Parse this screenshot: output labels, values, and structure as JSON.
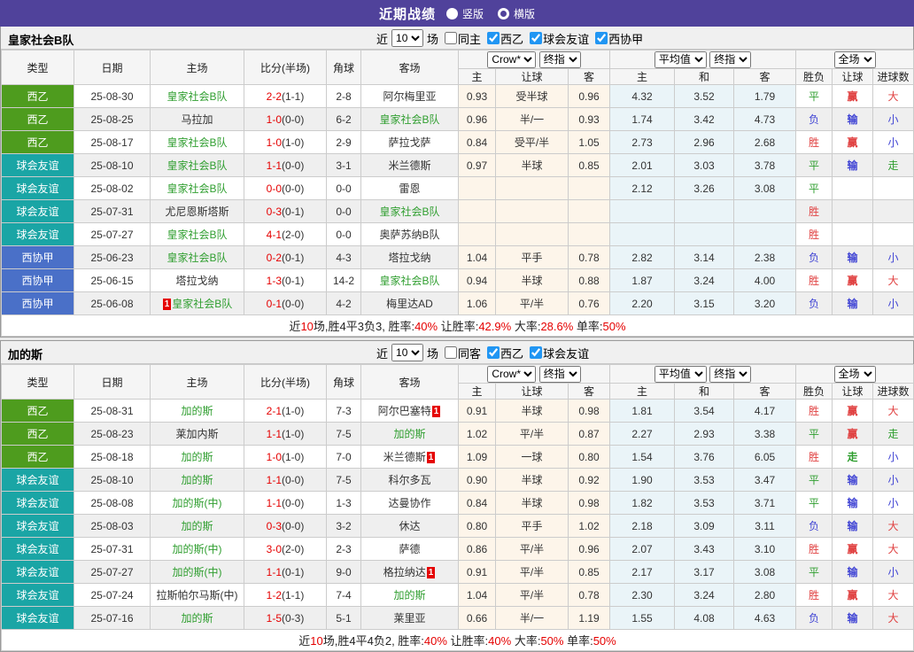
{
  "topbar": {
    "title": "近期战绩",
    "vertical_label": "竖版",
    "horizontal_label": "横版",
    "selected": "竖版"
  },
  "colors": {
    "topbar_bg": "#50429b",
    "league_green": "#4e9c1e",
    "league_teal": "#1aa5a5",
    "league_blue": "#4a70c8",
    "focus_team_green": "#2f9e2f",
    "score_red": "#e50000",
    "win_red": "#e04040",
    "lose_blue": "#4044d4",
    "draw_green": "#2f9e2f",
    "handicap_col_bg": "#fdf5ea",
    "avg_col_bg": "#eaf4f8",
    "zebra_gray": "#efefef",
    "checkbox_blue": "#2196f3"
  },
  "columns": {
    "type": "类型",
    "date": "日期",
    "home": "主场",
    "score": "比分(半场)",
    "corner": "角球",
    "away": "客场",
    "sub": [
      "主",
      "让球",
      "客",
      "主",
      "和",
      "客",
      "胜负",
      "让球",
      "进球数"
    ]
  },
  "dropdowns": {
    "handicap_source": "Crow*",
    "handicap_time": "终指",
    "europe_source": "平均值",
    "europe_time": "终指",
    "result_scope": "全场"
  },
  "tables": [
    {
      "team": "皇家社会B队",
      "filter": {
        "near_label": "近",
        "count": "10",
        "games_label": "场",
        "same_label": "同主",
        "same_checked": false,
        "leagues": [
          {
            "label": "西乙",
            "checked": true
          },
          {
            "label": "球会友谊",
            "checked": true
          },
          {
            "label": "西协甲",
            "checked": true
          }
        ]
      },
      "rows": [
        {
          "league": "西乙",
          "league_color": "green",
          "date": "25-08-30",
          "home": {
            "name": "皇家社会B队",
            "focus": true
          },
          "score": "2-2",
          "half": "(1-1)",
          "corner": "2-8",
          "away": {
            "name": "阿尔梅里亚",
            "focus": false
          },
          "odds": [
            "0.93",
            "受半球",
            "0.96"
          ],
          "avg": [
            "4.32",
            "3.52",
            "1.79"
          ],
          "result": [
            [
              "平",
              "green"
            ],
            [
              "赢",
              "red"
            ],
            [
              "大",
              "red"
            ]
          ]
        },
        {
          "league": "西乙",
          "league_color": "green",
          "date": "25-08-25",
          "home": {
            "name": "马拉加",
            "focus": false
          },
          "score": "1-0",
          "half": "(0-0)",
          "corner": "6-2",
          "away": {
            "name": "皇家社会B队",
            "focus": true
          },
          "odds": [
            "0.96",
            "半/一",
            "0.93"
          ],
          "avg": [
            "1.74",
            "3.42",
            "4.73"
          ],
          "result": [
            [
              "负",
              "blue"
            ],
            [
              "输",
              "blue"
            ],
            [
              "小",
              "blue"
            ]
          ]
        },
        {
          "league": "西乙",
          "league_color": "green",
          "date": "25-08-17",
          "home": {
            "name": "皇家社会B队",
            "focus": true
          },
          "score": "1-0",
          "half": "(1-0)",
          "corner": "2-9",
          "away": {
            "name": "萨拉戈萨",
            "focus": false
          },
          "odds": [
            "0.84",
            "受平/半",
            "1.05"
          ],
          "avg": [
            "2.73",
            "2.96",
            "2.68"
          ],
          "result": [
            [
              "胜",
              "red"
            ],
            [
              "赢",
              "red"
            ],
            [
              "小",
              "blue"
            ]
          ]
        },
        {
          "league": "球会友谊",
          "league_color": "teal",
          "date": "25-08-10",
          "home": {
            "name": "皇家社会B队",
            "focus": true
          },
          "score": "1-1",
          "half": "(0-0)",
          "corner": "3-1",
          "away": {
            "name": "米兰德斯",
            "focus": false
          },
          "odds": [
            "0.97",
            "半球",
            "0.85"
          ],
          "avg": [
            "2.01",
            "3.03",
            "3.78"
          ],
          "result": [
            [
              "平",
              "green"
            ],
            [
              "输",
              "blue"
            ],
            [
              "走",
              "green"
            ]
          ]
        },
        {
          "league": "球会友谊",
          "league_color": "teal",
          "date": "25-08-02",
          "home": {
            "name": "皇家社会B队",
            "focus": true
          },
          "score": "0-0",
          "half": "(0-0)",
          "corner": "0-0",
          "away": {
            "name": "雷恩",
            "focus": false
          },
          "odds": [
            "",
            "",
            ""
          ],
          "avg": [
            "2.12",
            "3.26",
            "3.08"
          ],
          "result": [
            [
              "平",
              "green"
            ],
            [
              "",
              ""
            ],
            [
              "",
              ""
            ]
          ]
        },
        {
          "league": "球会友谊",
          "league_color": "teal",
          "date": "25-07-31",
          "home": {
            "name": "尤尼恩斯塔斯",
            "focus": false
          },
          "score": "0-3",
          "half": "(0-1)",
          "corner": "0-0",
          "away": {
            "name": "皇家社会B队",
            "focus": true
          },
          "odds": [
            "",
            "",
            ""
          ],
          "avg": [
            "",
            "",
            ""
          ],
          "result": [
            [
              "胜",
              "red"
            ],
            [
              "",
              ""
            ],
            [
              "",
              ""
            ]
          ]
        },
        {
          "league": "球会友谊",
          "league_color": "teal",
          "date": "25-07-27",
          "home": {
            "name": "皇家社会B队",
            "focus": true
          },
          "score": "4-1",
          "half": "(2-0)",
          "corner": "0-0",
          "away": {
            "name": "奥萨苏纳B队",
            "focus": false
          },
          "odds": [
            "",
            "",
            ""
          ],
          "avg": [
            "",
            "",
            ""
          ],
          "result": [
            [
              "胜",
              "red"
            ],
            [
              "",
              ""
            ],
            [
              "",
              ""
            ]
          ]
        },
        {
          "league": "西协甲",
          "league_color": "blue",
          "date": "25-06-23",
          "home": {
            "name": "皇家社会B队",
            "focus": true
          },
          "score": "0-2",
          "half": "(0-1)",
          "corner": "4-3",
          "away": {
            "name": "塔拉戈纳",
            "focus": false
          },
          "odds": [
            "1.04",
            "平手",
            "0.78"
          ],
          "avg": [
            "2.82",
            "3.14",
            "2.38"
          ],
          "result": [
            [
              "负",
              "blue"
            ],
            [
              "输",
              "blue"
            ],
            [
              "小",
              "blue"
            ]
          ]
        },
        {
          "league": "西协甲",
          "league_color": "blue",
          "date": "25-06-15",
          "home": {
            "name": "塔拉戈纳",
            "focus": false
          },
          "score": "1-3",
          "half": "(0-1)",
          "corner": "14-2",
          "away": {
            "name": "皇家社会B队",
            "focus": true
          },
          "odds": [
            "0.94",
            "半球",
            "0.88"
          ],
          "avg": [
            "1.87",
            "3.24",
            "4.00"
          ],
          "result": [
            [
              "胜",
              "red"
            ],
            [
              "赢",
              "red"
            ],
            [
              "大",
              "red"
            ]
          ]
        },
        {
          "league": "西协甲",
          "league_color": "blue",
          "date": "25-06-08",
          "home": {
            "name": "皇家社会B队",
            "focus": true,
            "card": "1",
            "card_pos": "before"
          },
          "score": "0-1",
          "half": "(0-0)",
          "corner": "4-2",
          "away": {
            "name": "梅里达AD",
            "focus": false
          },
          "odds": [
            "1.06",
            "平/半",
            "0.76"
          ],
          "avg": [
            "2.20",
            "3.15",
            "3.20"
          ],
          "result": [
            [
              "负",
              "blue"
            ],
            [
              "输",
              "blue"
            ],
            [
              "小",
              "blue"
            ]
          ]
        }
      ],
      "summary": [
        {
          "t": "近",
          "red": false
        },
        {
          "t": "10",
          "red": true
        },
        {
          "t": "场,胜4平3负3, 胜率:",
          "red": false
        },
        {
          "t": "40%",
          "red": true
        },
        {
          "t": " 让胜率:",
          "red": false
        },
        {
          "t": "42.9%",
          "red": true
        },
        {
          "t": " 大率:",
          "red": false
        },
        {
          "t": "28.6%",
          "red": true
        },
        {
          "t": " 单率:",
          "red": false
        },
        {
          "t": "50%",
          "red": true
        }
      ]
    },
    {
      "team": "加的斯",
      "filter": {
        "near_label": "近",
        "count": "10",
        "games_label": "场",
        "same_label": "同客",
        "same_checked": false,
        "leagues": [
          {
            "label": "西乙",
            "checked": true
          },
          {
            "label": "球会友谊",
            "checked": true
          }
        ]
      },
      "rows": [
        {
          "league": "西乙",
          "league_color": "green",
          "date": "25-08-31",
          "home": {
            "name": "加的斯",
            "focus": true
          },
          "score": "2-1",
          "half": "(1-0)",
          "corner": "7-3",
          "away": {
            "name": "阿尔巴塞特",
            "focus": false,
            "card": "1",
            "card_pos": "after"
          },
          "odds": [
            "0.91",
            "半球",
            "0.98"
          ],
          "avg": [
            "1.81",
            "3.54",
            "4.17"
          ],
          "result": [
            [
              "胜",
              "red"
            ],
            [
              "赢",
              "red"
            ],
            [
              "大",
              "red"
            ]
          ]
        },
        {
          "league": "西乙",
          "league_color": "green",
          "date": "25-08-23",
          "home": {
            "name": "莱加内斯",
            "focus": false
          },
          "score": "1-1",
          "half": "(1-0)",
          "corner": "7-5",
          "away": {
            "name": "加的斯",
            "focus": true
          },
          "odds": [
            "1.02",
            "平/半",
            "0.87"
          ],
          "avg": [
            "2.27",
            "2.93",
            "3.38"
          ],
          "result": [
            [
              "平",
              "green"
            ],
            [
              "赢",
              "red"
            ],
            [
              "走",
              "green"
            ]
          ]
        },
        {
          "league": "西乙",
          "league_color": "green",
          "date": "25-08-18",
          "home": {
            "name": "加的斯",
            "focus": true
          },
          "score": "1-0",
          "half": "(1-0)",
          "corner": "7-0",
          "away": {
            "name": "米兰德斯",
            "focus": false,
            "card": "1",
            "card_pos": "after"
          },
          "odds": [
            "1.09",
            "一球",
            "0.80"
          ],
          "avg": [
            "1.54",
            "3.76",
            "6.05"
          ],
          "result": [
            [
              "胜",
              "red"
            ],
            [
              "走",
              "green"
            ],
            [
              "小",
              "blue"
            ]
          ]
        },
        {
          "league": "球会友谊",
          "league_color": "teal",
          "date": "25-08-10",
          "home": {
            "name": "加的斯",
            "focus": true
          },
          "score": "1-1",
          "half": "(0-0)",
          "corner": "7-5",
          "away": {
            "name": "科尔多瓦",
            "focus": false
          },
          "odds": [
            "0.90",
            "半球",
            "0.92"
          ],
          "avg": [
            "1.90",
            "3.53",
            "3.47"
          ],
          "result": [
            [
              "平",
              "green"
            ],
            [
              "输",
              "blue"
            ],
            [
              "小",
              "blue"
            ]
          ]
        },
        {
          "league": "球会友谊",
          "league_color": "teal",
          "date": "25-08-08",
          "home": {
            "name": "加的斯(中)",
            "focus": true
          },
          "score": "1-1",
          "half": "(0-0)",
          "corner": "1-3",
          "away": {
            "name": "达曼协作",
            "focus": false
          },
          "odds": [
            "0.84",
            "半球",
            "0.98"
          ],
          "avg": [
            "1.82",
            "3.53",
            "3.71"
          ],
          "result": [
            [
              "平",
              "green"
            ],
            [
              "输",
              "blue"
            ],
            [
              "小",
              "blue"
            ]
          ]
        },
        {
          "league": "球会友谊",
          "league_color": "teal",
          "date": "25-08-03",
          "home": {
            "name": "加的斯",
            "focus": true
          },
          "score": "0-3",
          "half": "(0-0)",
          "corner": "3-2",
          "away": {
            "name": "休达",
            "focus": false
          },
          "odds": [
            "0.80",
            "平手",
            "1.02"
          ],
          "avg": [
            "2.18",
            "3.09",
            "3.11"
          ],
          "result": [
            [
              "负",
              "blue"
            ],
            [
              "输",
              "blue"
            ],
            [
              "大",
              "red"
            ]
          ]
        },
        {
          "league": "球会友谊",
          "league_color": "teal",
          "date": "25-07-31",
          "home": {
            "name": "加的斯(中)",
            "focus": true
          },
          "score": "3-0",
          "half": "(2-0)",
          "corner": "2-3",
          "away": {
            "name": "萨德",
            "focus": false
          },
          "odds": [
            "0.86",
            "平/半",
            "0.96"
          ],
          "avg": [
            "2.07",
            "3.43",
            "3.10"
          ],
          "result": [
            [
              "胜",
              "red"
            ],
            [
              "赢",
              "red"
            ],
            [
              "大",
              "red"
            ]
          ]
        },
        {
          "league": "球会友谊",
          "league_color": "teal",
          "date": "25-07-27",
          "home": {
            "name": "加的斯(中)",
            "focus": true
          },
          "score": "1-1",
          "half": "(0-1)",
          "corner": "9-0",
          "away": {
            "name": "格拉纳达",
            "focus": false,
            "card": "1",
            "card_pos": "after"
          },
          "odds": [
            "0.91",
            "平/半",
            "0.85"
          ],
          "avg": [
            "2.17",
            "3.17",
            "3.08"
          ],
          "result": [
            [
              "平",
              "green"
            ],
            [
              "输",
              "blue"
            ],
            [
              "小",
              "blue"
            ]
          ]
        },
        {
          "league": "球会友谊",
          "league_color": "teal",
          "date": "25-07-24",
          "home": {
            "name": "拉斯帕尔马斯(中)",
            "focus": false
          },
          "score": "1-2",
          "half": "(1-1)",
          "corner": "7-4",
          "away": {
            "name": "加的斯",
            "focus": true
          },
          "odds": [
            "1.04",
            "平/半",
            "0.78"
          ],
          "avg": [
            "2.30",
            "3.24",
            "2.80"
          ],
          "result": [
            [
              "胜",
              "red"
            ],
            [
              "赢",
              "red"
            ],
            [
              "大",
              "red"
            ]
          ]
        },
        {
          "league": "球会友谊",
          "league_color": "teal",
          "date": "25-07-16",
          "home": {
            "name": "加的斯",
            "focus": true
          },
          "score": "1-5",
          "half": "(0-3)",
          "corner": "5-1",
          "away": {
            "name": "莱里亚",
            "focus": false
          },
          "odds": [
            "0.66",
            "半/一",
            "1.19"
          ],
          "avg": [
            "1.55",
            "4.08",
            "4.63"
          ],
          "result": [
            [
              "负",
              "blue"
            ],
            [
              "输",
              "blue"
            ],
            [
              "大",
              "red"
            ]
          ]
        }
      ],
      "summary": [
        {
          "t": "近",
          "red": false
        },
        {
          "t": "10",
          "red": true
        },
        {
          "t": "场,胜4平4负2, 胜率:",
          "red": false
        },
        {
          "t": "40%",
          "red": true
        },
        {
          "t": " 让胜率:",
          "red": false
        },
        {
          "t": "40%",
          "red": true
        },
        {
          "t": " 大率:",
          "red": false
        },
        {
          "t": "50%",
          "red": true
        },
        {
          "t": " 单率:",
          "red": false
        },
        {
          "t": "50%",
          "red": true
        }
      ]
    }
  ]
}
